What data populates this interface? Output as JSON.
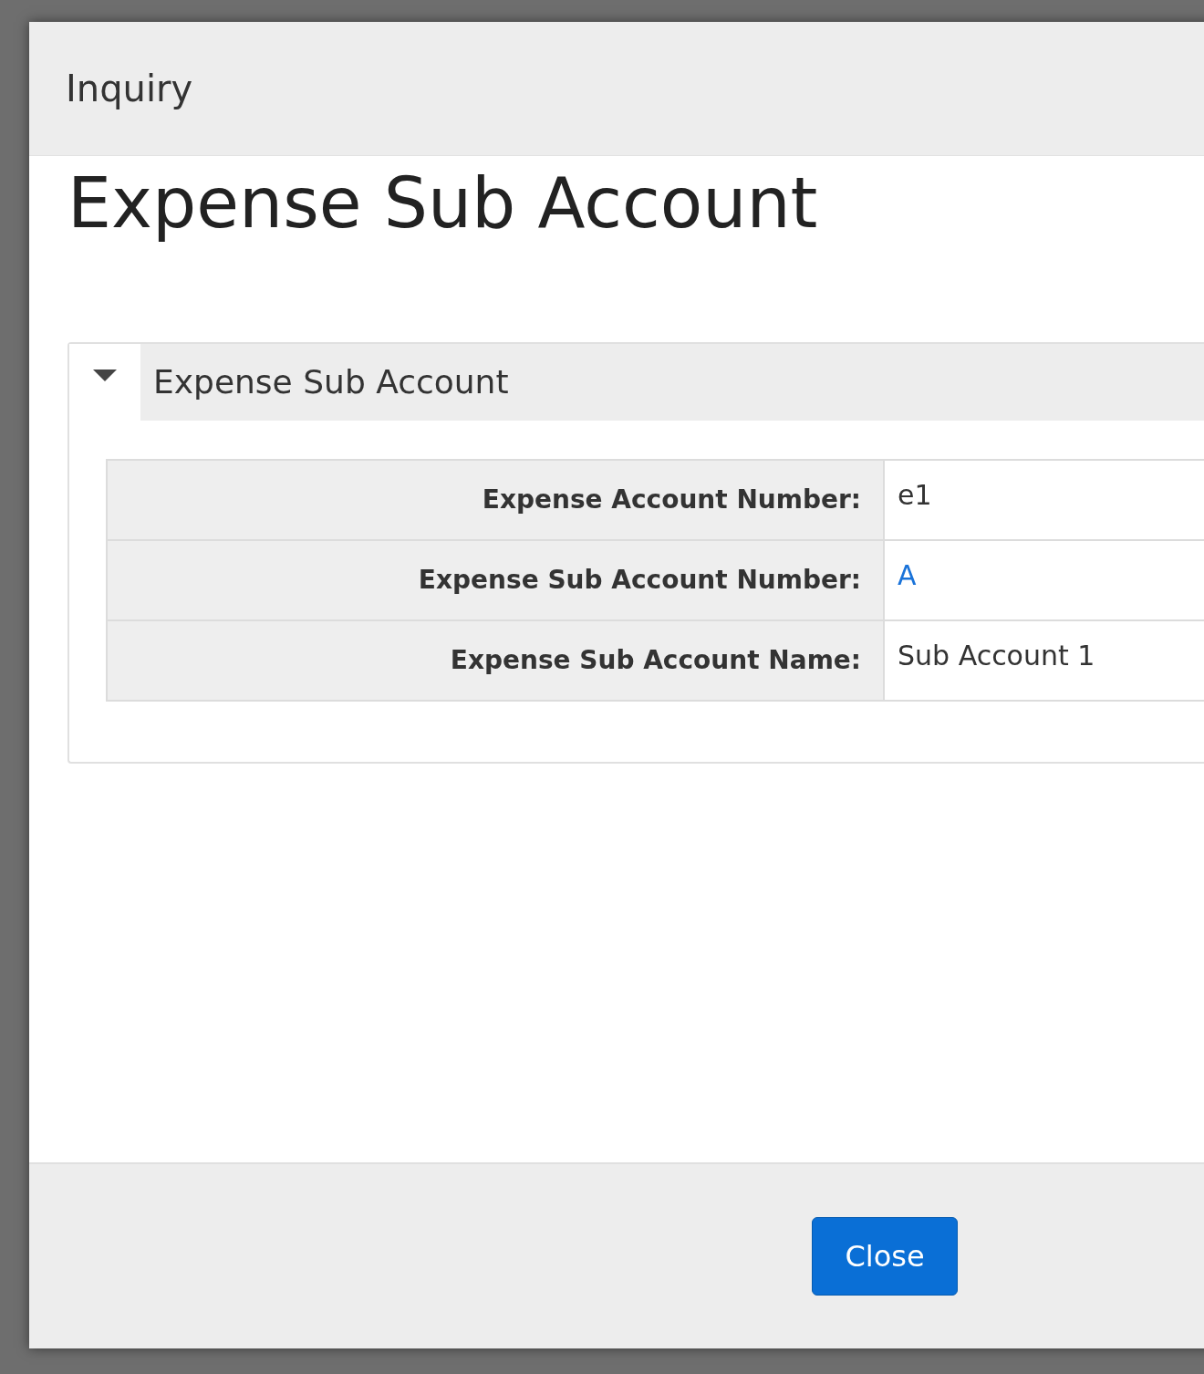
{
  "modal": {
    "title": "Inquiry",
    "heading": "Expense Sub Account"
  },
  "panel": {
    "title": "Expense Sub Account",
    "expanded": true,
    "rows": [
      {
        "label": "Expense Account Number:",
        "value": "e1",
        "kind": "text"
      },
      {
        "label": "Expense Sub Account Number:",
        "value": "A",
        "kind": "link"
      },
      {
        "label": "Expense Sub Account Name:",
        "value": "Sub Account 1",
        "kind": "text"
      }
    ]
  },
  "footer": {
    "buttons": [
      "Close"
    ]
  }
}
